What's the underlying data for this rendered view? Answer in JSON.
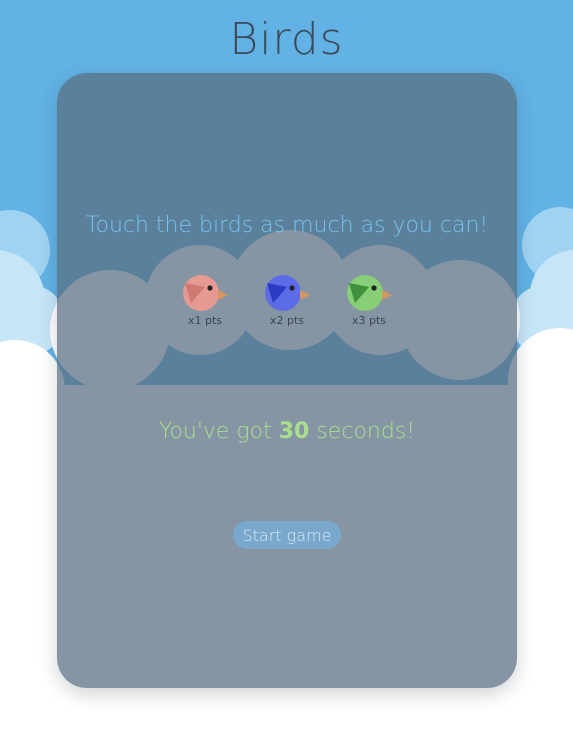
{
  "game": {
    "title": "Birds",
    "instructions": "Touch the birds as much as you can!",
    "birds": [
      {
        "points_label": "x1 pts",
        "color": "#e69a92",
        "wing": "#cf7a73",
        "icon": "pink-bird-icon"
      },
      {
        "points_label": "x2 pts",
        "color": "#5b6ce6",
        "wing": "#2b3cc4",
        "icon": "blue-bird-icon"
      },
      {
        "points_label": "x3 pts",
        "color": "#86cf76",
        "wing": "#3f8f3c",
        "icon": "green-bird-icon"
      }
    ],
    "time_prefix": "You've got ",
    "time_value": "30",
    "time_suffix": " seconds!",
    "start_label": "Start game"
  },
  "colors": {
    "sky": "#62b2e6",
    "cloud": "#ffffff",
    "title": "#3c4a57",
    "instructions": "#79c2ee",
    "time_text": "#a8e08e",
    "beak": "#d4955f"
  }
}
